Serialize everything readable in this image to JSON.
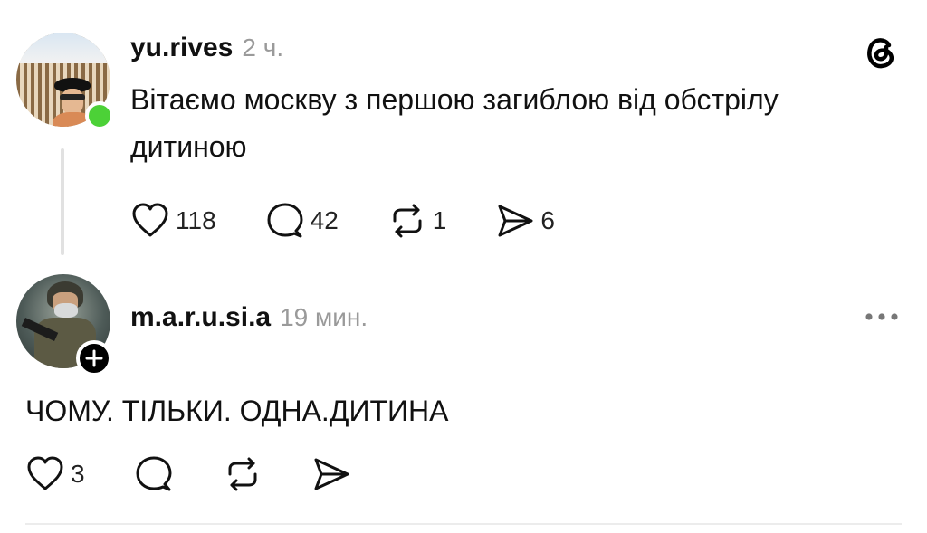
{
  "post": {
    "username": "yu.rives",
    "time": "2 ч.",
    "text_line1": "Вітаємо москву з першою загиблою від обстрілу",
    "text_line2": "дитиною",
    "likes": "118",
    "comments": "42",
    "reposts": "1",
    "shares": "6"
  },
  "reply": {
    "username": "m.a.r.u.si.a",
    "time": "19 мин.",
    "text": "ЧОМУ. ТІЛЬКИ. ОДНА.ДИТИНА",
    "likes": "3"
  },
  "icons": {
    "app_logo": "threads-logo",
    "like": "heart-icon",
    "comment": "comment-bubble-icon",
    "repost": "repost-icon",
    "share": "send-icon",
    "more": "more-dots-icon",
    "follow": "plus-icon"
  },
  "colors": {
    "online": "#4cd137",
    "muted_text": "#9a9a9a",
    "thread_line": "#e1e1e1"
  }
}
